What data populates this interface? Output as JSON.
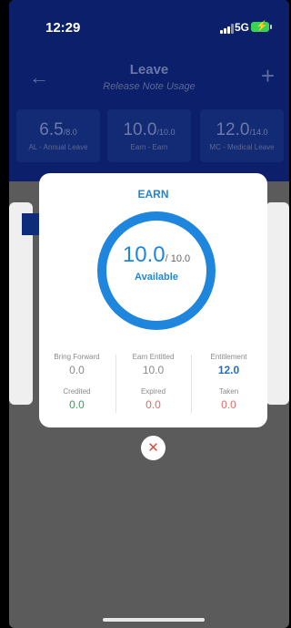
{
  "status_bar": {
    "time": "12:29",
    "network": "5G"
  },
  "header": {
    "title": "Leave",
    "subtitle": "Release Note Usage",
    "back_icon": "arrow-left-icon",
    "add_icon": "plus-icon"
  },
  "summary_cards": [
    {
      "value": "6.5",
      "total": "/8.0",
      "label": "AL - Annual Leave"
    },
    {
      "value": "10.0",
      "total": "/10.0",
      "label": "Earn - Earn"
    },
    {
      "value": "12.0",
      "total": "/14.0",
      "label": "MC - Medical Leave"
    }
  ],
  "modal": {
    "title": "EARN",
    "available_value": "10.0",
    "available_total": "/ 10.0",
    "available_label": "Available",
    "available_fraction": 1.0,
    "stats": [
      {
        "label": "Bring Forward",
        "value": "0.0",
        "color": "#8a8a8a"
      },
      {
        "label": "Earn Entitled",
        "value": "10.0",
        "color": "#8a8a8a"
      },
      {
        "label": "Entitlement",
        "value": "12.0",
        "color": "#1f6fc4"
      },
      {
        "label": "Credited",
        "value": "0.0",
        "color": "#2fa55a"
      },
      {
        "label": "Expired",
        "value": "0.0",
        "color": "#e06a6a"
      },
      {
        "label": "Taken",
        "value": "0.0",
        "color": "#e06a6a"
      }
    ],
    "close_icon": "close-icon"
  },
  "colors": {
    "header_bg": "#0b1f6a",
    "accent": "#1f86dd",
    "overlay": "#5b5b5b"
  }
}
